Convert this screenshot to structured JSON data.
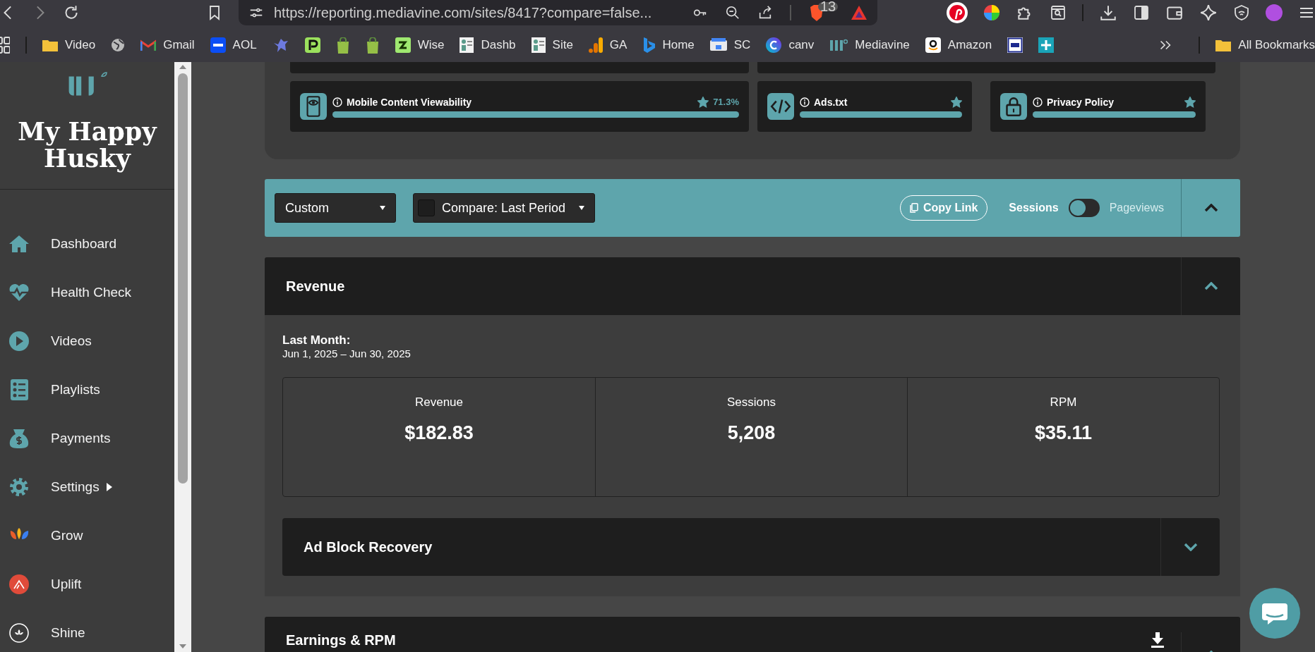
{
  "browser": {
    "url": "https://reporting.mediavine.com/sites/8417?compare=false...",
    "extension_badge": "13",
    "bookmarks": [
      {
        "kind": "folder",
        "label": "Video"
      },
      {
        "kind": "globe"
      },
      {
        "kind": "gmail",
        "label": "Gmail"
      },
      {
        "kind": "aol",
        "label": "AOL"
      },
      {
        "kind": "bird"
      },
      {
        "kind": "p"
      },
      {
        "kind": "shop"
      },
      {
        "kind": "shop"
      },
      {
        "kind": "wise",
        "label": "Wise"
      },
      {
        "kind": "thumb",
        "label": "Dashb"
      },
      {
        "kind": "thumb",
        "label": "Site"
      },
      {
        "kind": "ga",
        "label": "GA"
      },
      {
        "kind": "bing",
        "label": "Home"
      },
      {
        "kind": "sc",
        "label": "SC"
      },
      {
        "kind": "canva",
        "label": "canv"
      },
      {
        "kind": "mv",
        "label": "Mediavine"
      },
      {
        "kind": "amazon",
        "label": "Amazon"
      },
      {
        "kind": "cb"
      },
      {
        "kind": "plus"
      }
    ],
    "all_bookmarks": "All Bookmarks"
  },
  "sidebar": {
    "site_name": "My Happy Husky",
    "items": [
      {
        "kind": "home",
        "label": "Dashboard",
        "submenu": false
      },
      {
        "kind": "heart",
        "label": "Health Check",
        "submenu": false
      },
      {
        "kind": "play",
        "label": "Videos",
        "submenu": false
      },
      {
        "kind": "list",
        "label": "Playlists",
        "submenu": false
      },
      {
        "kind": "money",
        "label": "Payments",
        "submenu": false
      },
      {
        "kind": "gear",
        "label": "Settings",
        "submenu": true
      },
      {
        "kind": "grow",
        "label": "Grow",
        "submenu": false
      },
      {
        "kind": "uplift",
        "label": "Uplift",
        "submenu": false
      },
      {
        "kind": "shine",
        "label": "Shine",
        "submenu": false
      }
    ]
  },
  "health_cards": [
    {
      "kind": "phone",
      "title": "Mobile Content Viewability",
      "starred": true,
      "reading": "71.3%",
      "level": 1
    },
    {
      "kind": "code",
      "title": "Ads.txt",
      "starred": true,
      "level": 1
    },
    {
      "kind": "lock",
      "title": "Privacy Policy",
      "starred": true,
      "level": 1
    }
  ],
  "toolbar": {
    "range": "Custom",
    "compare": {
      "checked": false,
      "label": "Compare: Last Period"
    },
    "copy_link": "Copy Link",
    "metric_toggle": [
      {
        "label": "Sessions",
        "selected": true
      },
      {
        "label": "Pageviews",
        "selected": false
      }
    ],
    "expanded": true
  },
  "revenue": {
    "title": "Revenue",
    "expanded": true,
    "period_label": "Last Month:",
    "period": "Jun 1, 2025 – Jun 30, 2025",
    "stats": [
      {
        "label": "Revenue",
        "value": "$182.83"
      },
      {
        "label": "Sessions",
        "value": "5,208"
      },
      {
        "label": "RPM",
        "value": "$35.11"
      }
    ],
    "subsections": [
      {
        "title": "Ad Block Recovery",
        "expanded": false
      }
    ]
  },
  "earnings": {
    "title": "Earnings & RPM",
    "expanded": true
  }
}
